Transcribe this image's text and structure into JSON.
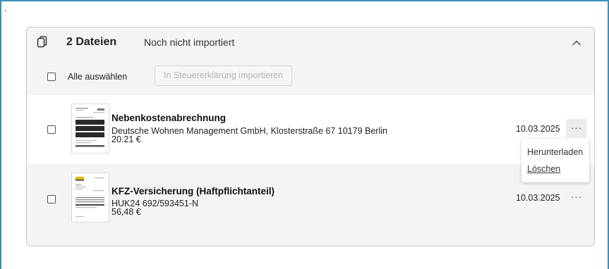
{
  "page": {
    "marker": "."
  },
  "card": {
    "file_count": "2 Dateien",
    "status": "Noch nicht importiert",
    "select_all_label": "Alle auswählen",
    "import_button_label": "In Steuererklärung importieren"
  },
  "documents": [
    {
      "title": "Nebenkostenabrechnung",
      "subtitle": "Deutsche Wohnen Management GmbH, Klosterstraße 67 10179 Berlin",
      "amount": "20.21 €",
      "date": "10.03.2025",
      "more_label": "···"
    },
    {
      "title": "KFZ-Versicherung (Haftpflichtanteil)",
      "subtitle": "HUK24 692/593451-N",
      "amount": "56,48 €",
      "date": "10.03.2025",
      "more_label": "···"
    }
  ],
  "context_menu": {
    "items": [
      "Herunterladen",
      "Löschen"
    ]
  },
  "icons": {
    "files": "files-icon",
    "collapse": "chevron-up-icon",
    "more": "more-horizontal-icon"
  },
  "colors": {
    "frame_border": "#3a8fb8",
    "card_bg": "#f4f4f4",
    "disabled_text": "#b3b3b3"
  }
}
